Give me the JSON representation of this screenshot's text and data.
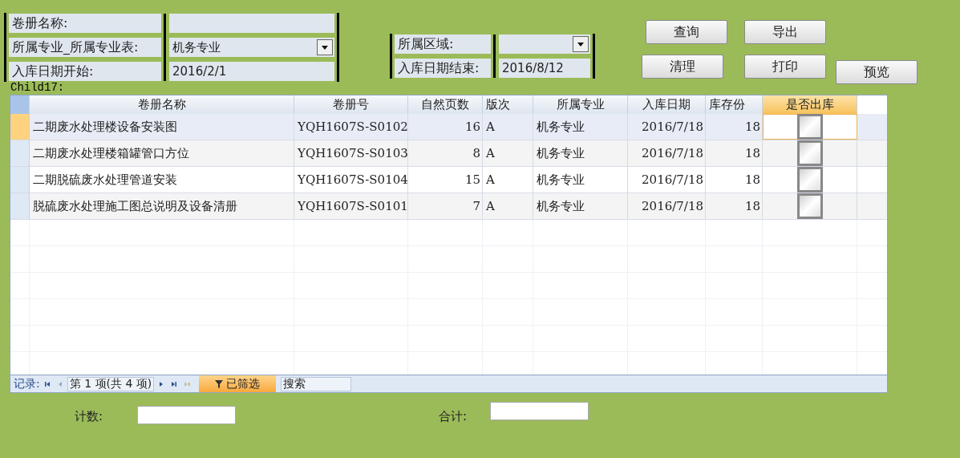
{
  "filters_left": [
    {
      "label": "卷册名称:",
      "kind": "text"
    },
    {
      "label": "所属专业_所属专业表:",
      "value": "机务专业",
      "kind": "dropdown"
    },
    {
      "label": "入库日期开始:",
      "value": "2016/2/1",
      "kind": "text"
    }
  ],
  "filters_right": [
    {
      "label": "所属区域:",
      "kind": "dropdown"
    },
    {
      "label": "入库日期结束:",
      "value": "2016/8/12",
      "kind": "text"
    }
  ],
  "buttons": [
    {
      "label": "查询"
    },
    {
      "label": "导出"
    },
    {
      "label": "清理"
    },
    {
      "label": "打印"
    },
    {
      "label": "预览"
    }
  ],
  "subform_label": "Child17:",
  "table": {
    "columns": [
      {
        "label": "卷册名称",
        "kind": "text"
      },
      {
        "label": "卷册号",
        "kind": "text"
      },
      {
        "label": "自然页数",
        "kind": "number"
      },
      {
        "label": "版次",
        "kind": "text"
      },
      {
        "label": "所属专业",
        "kind": "text"
      },
      {
        "label": "入库日期",
        "kind": "date"
      },
      {
        "label": "库存份",
        "kind": "number"
      },
      {
        "label": "是否出库",
        "kind": "checkbox"
      }
    ],
    "rows": [
      {
        "selected": true,
        "cells": [
          "二期废水处理楼设备安装图",
          "YQH1607S-S0102",
          "16",
          "A",
          "机务专业",
          "2016/7/18",
          "18"
        ],
        "checked": false
      },
      {
        "selected": false,
        "cells": [
          "二期废水处理楼箱罐管口方位",
          "YQH1607S-S0103",
          "8",
          "A",
          "机务专业",
          "2016/7/18",
          "18"
        ],
        "checked": false
      },
      {
        "selected": false,
        "cells": [
          "二期脱硫废水处理管道安装",
          "YQH1607S-S0104",
          "15",
          "A",
          "机务专业",
          "2016/7/18",
          "18"
        ],
        "checked": false
      },
      {
        "selected": false,
        "cells": [
          "脱硫废水处理施工图总说明及设备清册",
          "YQH1607S-S0101",
          "7",
          "A",
          "机务专业",
          "2016/7/18",
          "18"
        ],
        "checked": false
      }
    ]
  },
  "navigation": {
    "label": "记录:",
    "position": "第 1 项(共 4 项)",
    "filter": "已筛选",
    "search": "搜索"
  },
  "totals": [
    {
      "label": "计数:"
    },
    {
      "label": "合计:"
    }
  ]
}
